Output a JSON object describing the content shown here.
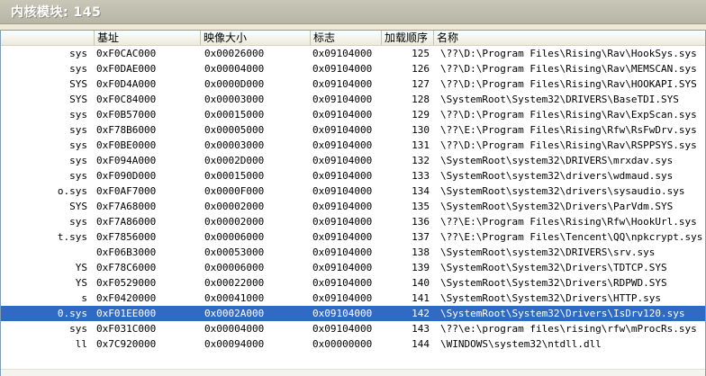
{
  "title": "内核模块: 145",
  "columns": [
    "",
    "基址",
    "映像大小",
    "标志",
    "加载顺序",
    "名称"
  ],
  "rows": [
    {
      "name": "sys",
      "base": "0xF0CAC000",
      "size": "0x00026000",
      "flags": "0x09104000",
      "order": "125",
      "path": "\\??\\D:\\Program Files\\Rising\\Rav\\HookSys.sys"
    },
    {
      "name": "sys",
      "base": "0xF0DAE000",
      "size": "0x00004000",
      "flags": "0x09104000",
      "order": "126",
      "path": "\\??\\D:\\Program Files\\Rising\\Rav\\MEMSCAN.sys"
    },
    {
      "name": "SYS",
      "base": "0xF0D4A000",
      "size": "0x0000D000",
      "flags": "0x09104000",
      "order": "127",
      "path": "\\??\\D:\\Program Files\\Rising\\Rav\\HOOKAPI.SYS"
    },
    {
      "name": "SYS",
      "base": "0xF0C84000",
      "size": "0x00003000",
      "flags": "0x09104000",
      "order": "128",
      "path": "\\SystemRoot\\System32\\DRIVERS\\BaseTDI.SYS"
    },
    {
      "name": "sys",
      "base": "0xF0B57000",
      "size": "0x00015000",
      "flags": "0x09104000",
      "order": "129",
      "path": "\\??\\D:\\Program Files\\Rising\\Rav\\ExpScan.sys"
    },
    {
      "name": "sys",
      "base": "0xF78B6000",
      "size": "0x00005000",
      "flags": "0x09104000",
      "order": "130",
      "path": "\\??\\E:\\Program Files\\Rising\\Rfw\\RsFwDrv.sys"
    },
    {
      "name": "sys",
      "base": "0xF0BE0000",
      "size": "0x00003000",
      "flags": "0x09104000",
      "order": "131",
      "path": "\\??\\D:\\Program Files\\Rising\\Rav\\RSPPSYS.sys"
    },
    {
      "name": "sys",
      "base": "0xF094A000",
      "size": "0x0002D000",
      "flags": "0x09104000",
      "order": "132",
      "path": "\\SystemRoot\\system32\\DRIVERS\\mrxdav.sys"
    },
    {
      "name": "sys",
      "base": "0xF090D000",
      "size": "0x00015000",
      "flags": "0x09104000",
      "order": "133",
      "path": "\\SystemRoot\\system32\\drivers\\wdmaud.sys"
    },
    {
      "name": "o.sys",
      "base": "0xF0AF7000",
      "size": "0x0000F000",
      "flags": "0x09104000",
      "order": "134",
      "path": "\\SystemRoot\\system32\\drivers\\sysaudio.sys"
    },
    {
      "name": "SYS",
      "base": "0xF7A68000",
      "size": "0x00002000",
      "flags": "0x09104000",
      "order": "135",
      "path": "\\SystemRoot\\System32\\Drivers\\ParVdm.SYS"
    },
    {
      "name": "sys",
      "base": "0xF7A86000",
      "size": "0x00002000",
      "flags": "0x09104000",
      "order": "136",
      "path": "\\??\\E:\\Program Files\\Rising\\Rfw\\HookUrl.sys"
    },
    {
      "name": "t.sys",
      "base": "0xF7856000",
      "size": "0x00006000",
      "flags": "0x09104000",
      "order": "137",
      "path": "\\??\\E:\\Program Files\\Tencent\\QQ\\npkcrypt.sys"
    },
    {
      "name": "",
      "base": "0xF06B3000",
      "size": "0x00053000",
      "flags": "0x09104000",
      "order": "138",
      "path": "\\SystemRoot\\system32\\DRIVERS\\srv.sys"
    },
    {
      "name": "YS",
      "base": "0xF78C6000",
      "size": "0x00006000",
      "flags": "0x09104000",
      "order": "139",
      "path": "\\SystemRoot\\System32\\Drivers\\TDTCP.SYS"
    },
    {
      "name": "YS",
      "base": "0xF0529000",
      "size": "0x00022000",
      "flags": "0x09104000",
      "order": "140",
      "path": "\\SystemRoot\\System32\\Drivers\\RDPWD.SYS"
    },
    {
      "name": "s",
      "base": "0xF0420000",
      "size": "0x00041000",
      "flags": "0x09104000",
      "order": "141",
      "path": "\\SystemRoot\\System32\\Drivers\\HTTP.sys"
    },
    {
      "name": "0.sys",
      "base": "0xF01EE000",
      "size": "0x0002A000",
      "flags": "0x09104000",
      "order": "142",
      "path": "\\SystemRoot\\System32\\Drivers\\IsDrv120.sys",
      "selected": true
    },
    {
      "name": "sys",
      "base": "0xF031C000",
      "size": "0x00004000",
      "flags": "0x09104000",
      "order": "143",
      "path": "\\??\\e:\\program files\\rising\\rfw\\mProcRs.sys"
    },
    {
      "name": "ll",
      "base": "0x7C920000",
      "size": "0x00094000",
      "flags": "0x00000000",
      "order": "144",
      "path": "\\WINDOWS\\system32\\ntdll.dll"
    }
  ]
}
